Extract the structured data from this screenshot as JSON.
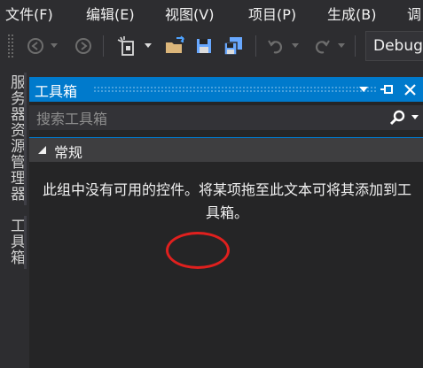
{
  "menu": {
    "file": "文件(F)",
    "edit": "编辑(E)",
    "view": "视图(V)",
    "project": "项目(P)",
    "build": "生成(B)",
    "debug_partial": "调"
  },
  "toolbar": {
    "configuration": "Debug",
    "icons": [
      "back-icon",
      "forward-icon",
      "new-project-icon",
      "open-folder-icon",
      "save-icon",
      "save-all-icon",
      "undo-icon",
      "redo-icon"
    ]
  },
  "left_tabs": {
    "server_explorer": "服务器资源管理器",
    "toolbox": "工具箱"
  },
  "toolbox": {
    "title": "工具箱",
    "search_placeholder": "搜索工具箱",
    "group_name": "常规",
    "empty_message": "此组中没有可用的控件。将某项拖至此文本可将其添加到工具箱。"
  },
  "colors": {
    "background": "#2d2d30",
    "panel": "#252526",
    "accent": "#007acc",
    "annotation": "#e0201e"
  }
}
